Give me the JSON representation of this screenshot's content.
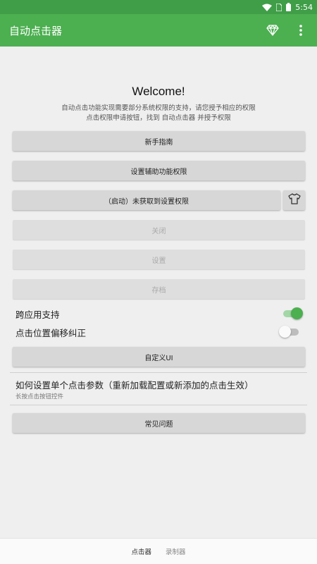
{
  "status_bar": {
    "time": "5:54",
    "icons": [
      "wifi-icon",
      "sim-icon",
      "battery-icon"
    ]
  },
  "app_bar": {
    "title": "自动点击器",
    "actions": [
      "diamond-icon",
      "more-vert-icon"
    ]
  },
  "main": {
    "welcome": "Welcome!",
    "desc_line1": "自动点击功能实现需要部分系统权限的支持，请您授予相应的权限",
    "desc_line2": "点击权限申请按钮，找到 自动点击器 并授予权限",
    "buttons": {
      "guide": "新手指南",
      "accessibility": "设置辅助功能权限",
      "setting_permission": "（启动）未获取到设置权限",
      "close": "关闭",
      "settings": "设置",
      "archive": "存档",
      "custom_ui": "自定义UI",
      "faq": "常见问题"
    },
    "toggles": {
      "cross_app_label": "跨应用支持",
      "cross_app_on": true,
      "offset_label": "点击位置偏移纠正",
      "offset_on": false
    },
    "help": {
      "title": "如何设置单个点击参数（重新加载配置或新添加的点击生效）",
      "subtitle": "长按点击按钮控件"
    }
  },
  "bottom_nav": {
    "clicker": "点击器",
    "recorder": "录制器",
    "active": "clicker"
  },
  "colors": {
    "primary": "#4caf50",
    "status_bar": "#3f9e47",
    "button": "#d7d7d7",
    "background": "#efefef"
  }
}
